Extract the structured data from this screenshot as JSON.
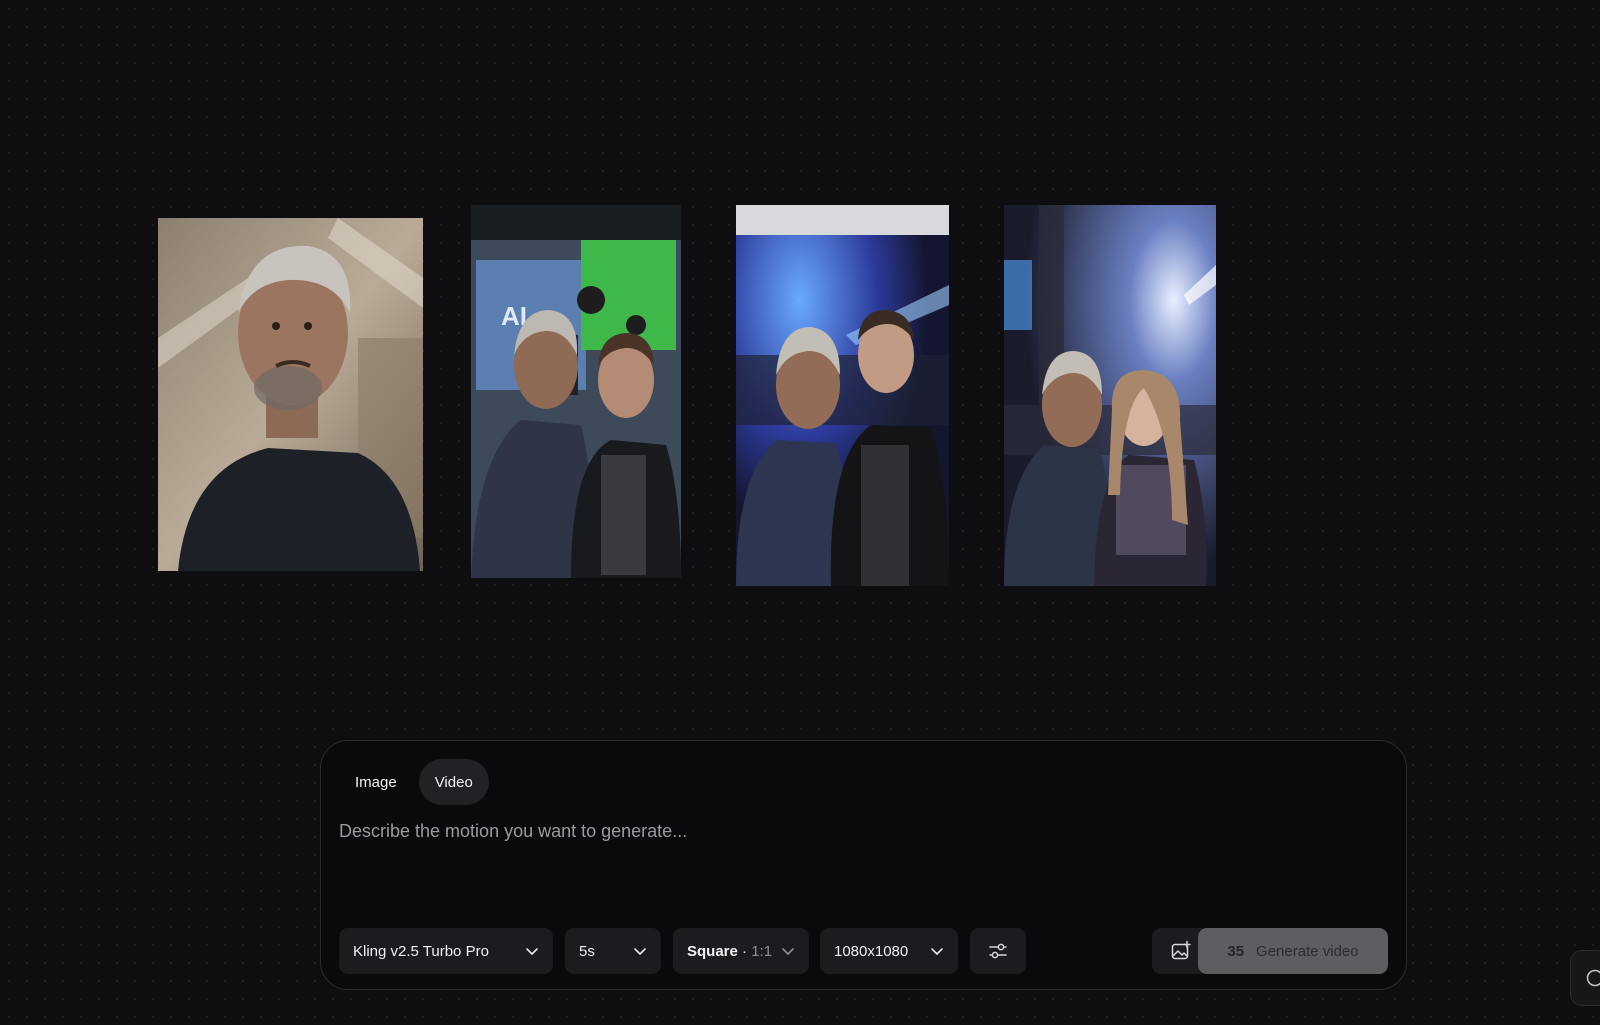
{
  "gallery": {
    "images": [
      {
        "icon": "portrait-photo",
        "scene": "selfie-hoodie-skylight"
      },
      {
        "icon": "portrait-photo",
        "scene": "selfie-green-screen-studio"
      },
      {
        "icon": "portrait-photo",
        "scene": "selfie-convention-stage"
      },
      {
        "icon": "portrait-photo",
        "scene": "selfie-concert-stage"
      }
    ]
  },
  "composer": {
    "tabs": [
      {
        "label": "Image",
        "active": false
      },
      {
        "label": "Video",
        "active": true
      }
    ],
    "prompt": {
      "placeholder": "Describe the motion you want to generate...",
      "value": ""
    },
    "model": {
      "value": "Kling v2.5 Turbo Pro",
      "icon": "chevron-down-icon"
    },
    "duration": {
      "value": "5s",
      "icon": "chevron-down-icon"
    },
    "aspect": {
      "label": "Square",
      "separator": "·",
      "ratio": "1:1",
      "icon": "chevron-down-icon"
    },
    "resolution": {
      "value": "1080x1080",
      "icon": "chevron-down-icon"
    },
    "settings_icon": "sliders-icon",
    "image_icon": "image-add-icon",
    "generate": {
      "credits": "35",
      "label": "Generate video"
    }
  },
  "colors": {
    "background": "#0e0e11",
    "panel": "#0a0a0c",
    "control": "#1c1c20",
    "generate_disabled": "#5e5e62"
  }
}
